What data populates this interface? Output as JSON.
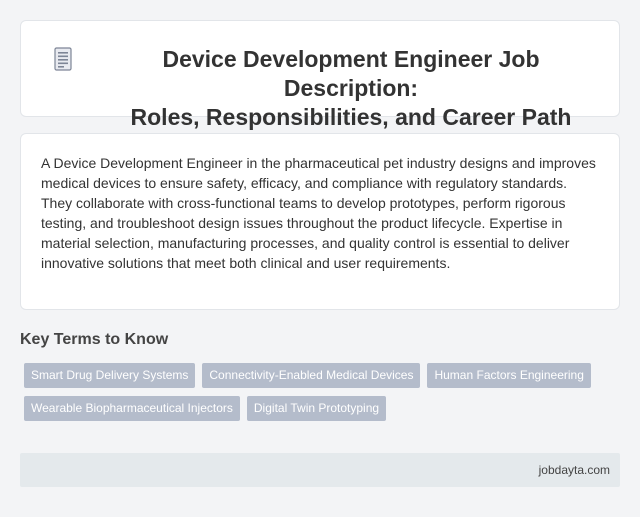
{
  "header": {
    "icon": "document-icon",
    "title_line1": "Device Development Engineer Job Description:",
    "title_line2": "Roles, Responsibilities, and Career Path"
  },
  "description": "A Device Development Engineer in the pharmaceutical pet industry designs and improves medical devices to ensure safety, efficacy, and compliance with regulatory standards. They collaborate with cross-functional teams to develop prototypes, perform rigorous testing, and troubleshoot design issues throughout the product lifecycle. Expertise in material selection, manufacturing processes, and quality control is essential to deliver innovative solutions that meet both clinical and user requirements.",
  "key_terms": {
    "heading": "Key Terms to Know",
    "tags": [
      "Smart Drug Delivery Systems",
      "Connectivity-Enabled Medical Devices",
      "Human Factors Engineering",
      "Wearable Biopharmaceutical Injectors",
      "Digital Twin Prototyping"
    ]
  },
  "footer": {
    "site": "jobdayta.com"
  },
  "colors": {
    "background": "#f3f4f6",
    "tag": "#b4bccb",
    "footer": "#e4e9ec"
  }
}
